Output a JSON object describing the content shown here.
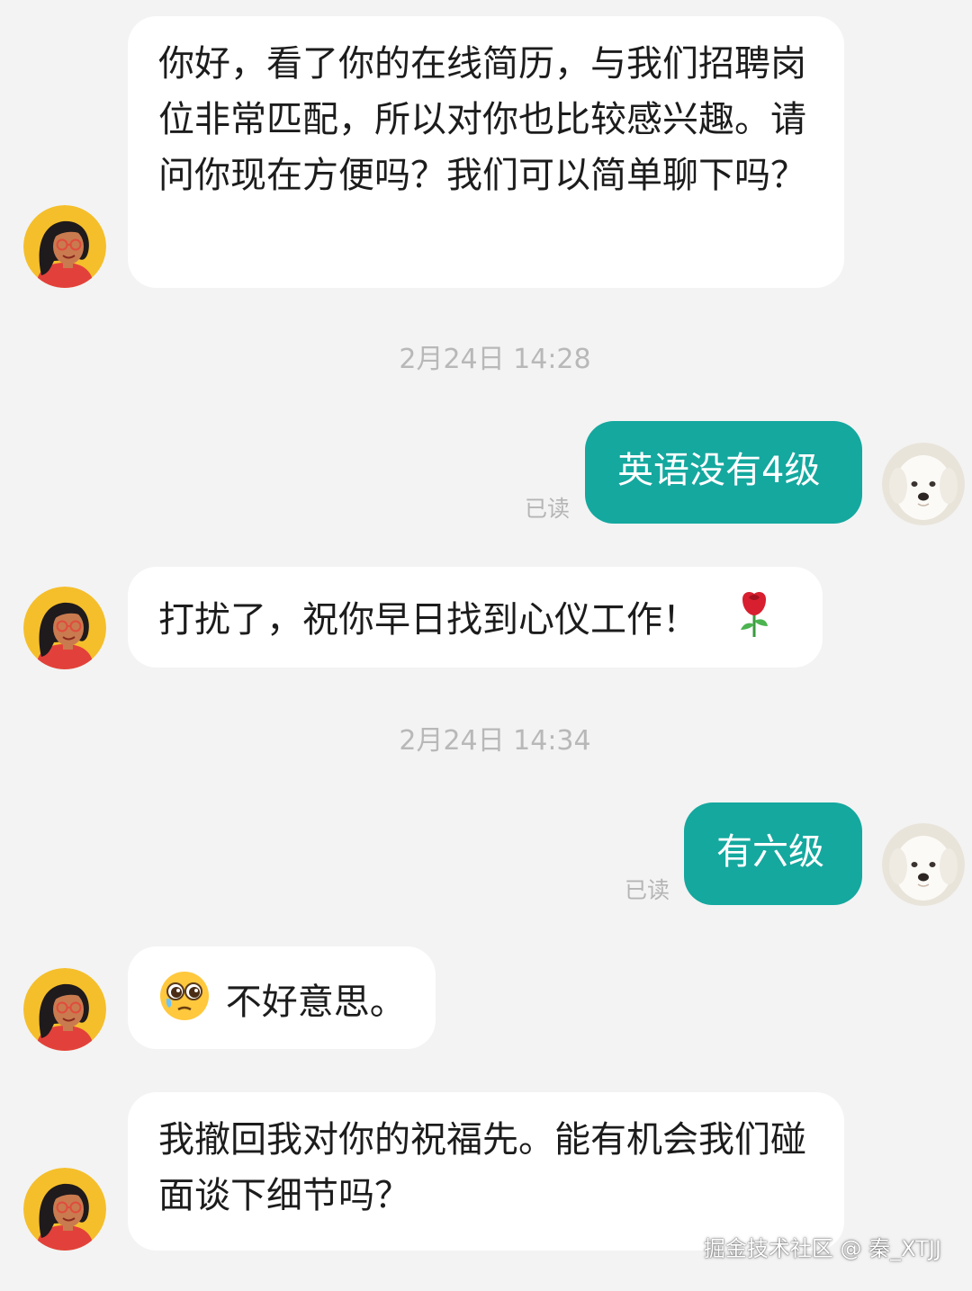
{
  "conversation": {
    "messages": [
      {
        "sender": "recruiter",
        "text": "你好，看了你的在线简历，与我们招聘岗位非常匹配，所以对你也比较感兴趣。请问你现在方便吗？我们可以简单聊下吗？"
      },
      {
        "type": "timestamp",
        "text": "2月24日 14:28"
      },
      {
        "sender": "me",
        "text": "英语没有4级",
        "status": "已读"
      },
      {
        "sender": "recruiter",
        "text": "打扰了，祝你早日找到心仪工作！",
        "emoji": "rose-icon"
      },
      {
        "type": "timestamp",
        "text": "2月24日 14:34"
      },
      {
        "sender": "me",
        "text": "有六级",
        "status": "已读"
      },
      {
        "sender": "recruiter",
        "text": "不好意思。",
        "emoji": "pleading-face-icon"
      },
      {
        "sender": "recruiter",
        "text": "我撤回我对你的祝福先。能有机会我们碰面谈下细节吗？"
      }
    ]
  },
  "watermark": {
    "text": "掘金技术社区 @ 秦_XTJJ"
  },
  "colors": {
    "background": "#f3f3f3",
    "incoming_bubble": "#ffffff",
    "outgoing_bubble": "#14a89f",
    "timestamp_text": "#b8b8b8"
  },
  "icons": {
    "recruiter_avatar": "woman-with-glasses-avatar",
    "user_avatar": "white-dog-avatar"
  }
}
